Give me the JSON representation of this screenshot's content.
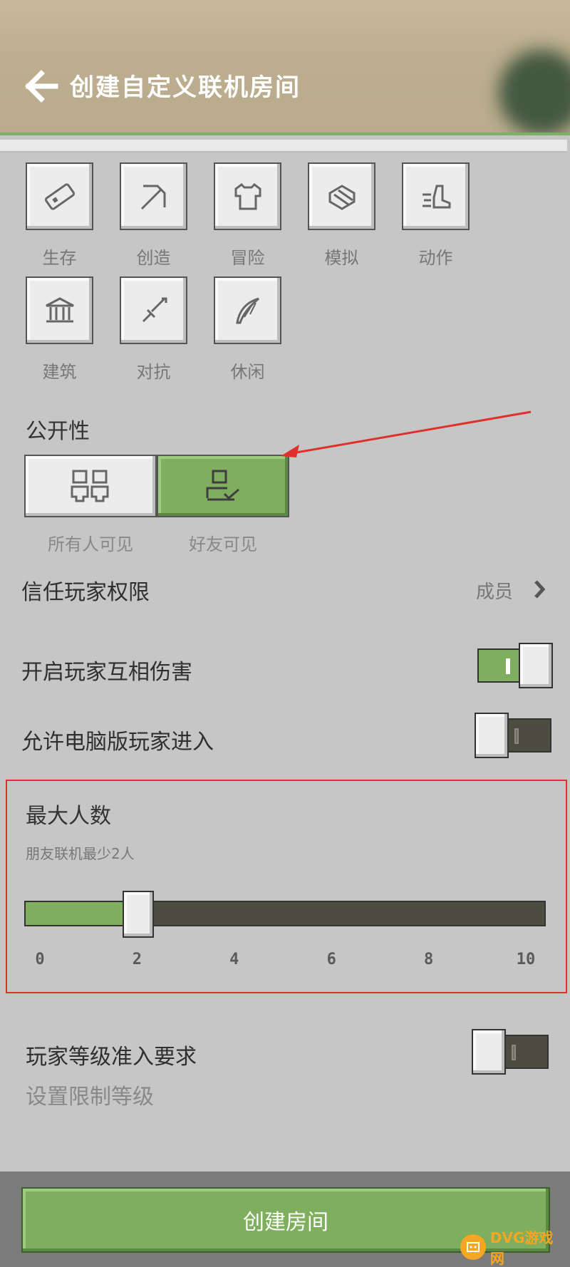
{
  "header": {
    "title": "创建自定义联机房间"
  },
  "categories": [
    {
      "label": "生存",
      "icon": "tag-icon"
    },
    {
      "label": "创造",
      "icon": "pickaxe-icon"
    },
    {
      "label": "冒险",
      "icon": "shirt-icon"
    },
    {
      "label": "模拟",
      "icon": "cube-icon"
    },
    {
      "label": "动作",
      "icon": "boot-icon"
    },
    {
      "label": "建筑",
      "icon": "temple-icon"
    },
    {
      "label": "对抗",
      "icon": "sword-icon"
    },
    {
      "label": "休闲",
      "icon": "feather-icon"
    }
  ],
  "visibility": {
    "title": "公开性",
    "options": [
      {
        "label": "所有人可见",
        "selected": false
      },
      {
        "label": "好友可见",
        "selected": true
      }
    ]
  },
  "trust": {
    "label": "信任玩家权限",
    "value": "成员"
  },
  "pvp": {
    "label": "开启玩家互相伤害",
    "enabled": true
  },
  "pc_players": {
    "label": "允许电脑版玩家进入",
    "enabled": false
  },
  "max_players": {
    "title": "最大人数",
    "hint": "朋友联机最少2人",
    "value": 2,
    "min": 0,
    "max": 10,
    "ticks": [
      "0",
      "2",
      "4",
      "6",
      "8",
      "10"
    ]
  },
  "level_req": {
    "label": "玩家等级准入要求",
    "sublabel": "设置限制等级",
    "enabled": false
  },
  "create_button": {
    "label": "创建房间"
  },
  "watermark": {
    "text": "DVG游戏网"
  },
  "colors": {
    "accent_green": "#7fae5e",
    "annotation_red": "#e0302b"
  }
}
